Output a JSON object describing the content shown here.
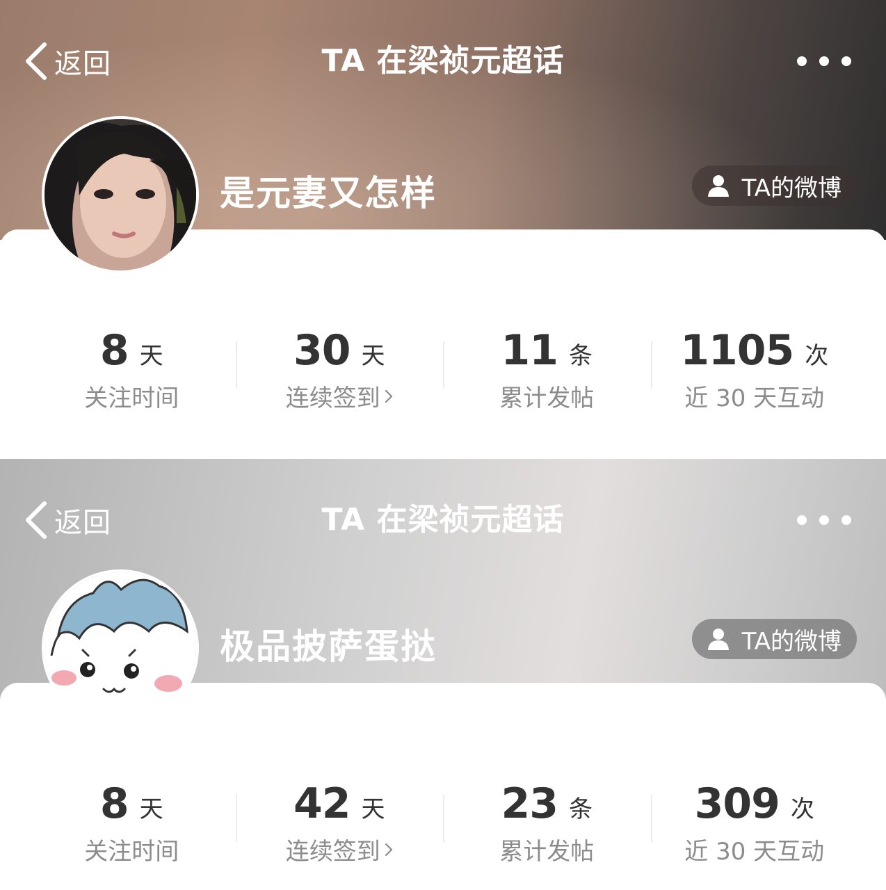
{
  "colors": {
    "white": "#ffffff",
    "number": "#333333",
    "label": "#8c8c8c"
  },
  "panels": [
    {
      "nav": {
        "back_label": "返回",
        "title": "TA 在梁祯元超话",
        "more_icon": "more-icon"
      },
      "profile": {
        "username": "是元妻又怎样",
        "weibo_button": "TA的微博",
        "avatar": "user-avatar-photo"
      },
      "stats": [
        {
          "value": "8",
          "unit": "天",
          "label": "关注时间"
        },
        {
          "value": "30",
          "unit": "天",
          "label": "连续签到"
        },
        {
          "value": "11",
          "unit": "条",
          "label": "累计发帖"
        },
        {
          "value": "1105",
          "unit": "次",
          "label": "近 30 天互动"
        }
      ]
    },
    {
      "nav": {
        "back_label": "返回",
        "title": "TA 在梁祯元超话",
        "more_icon": "more-icon"
      },
      "profile": {
        "username": "极品披萨蛋挞",
        "weibo_button": "TA的微博",
        "avatar": "cartoon-avatar"
      },
      "stats": [
        {
          "value": "8",
          "unit": "天",
          "label": "关注时间"
        },
        {
          "value": "42",
          "unit": "天",
          "label": "连续签到"
        },
        {
          "value": "23",
          "unit": "条",
          "label": "累计发帖"
        },
        {
          "value": "309",
          "unit": "次",
          "label": "近 30 天互动"
        }
      ]
    }
  ]
}
